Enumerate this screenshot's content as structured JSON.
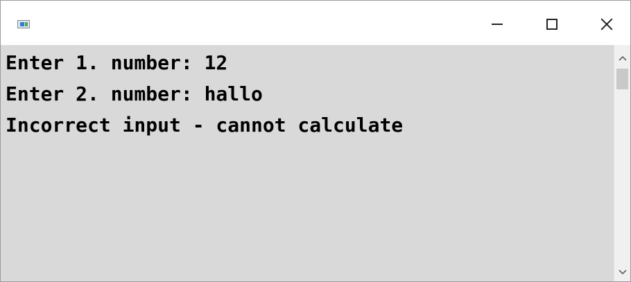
{
  "window": {
    "icon": "console-app-icon",
    "controls": {
      "minimize": "minimize-icon",
      "maximize": "maximize-icon",
      "close": "close-icon"
    }
  },
  "console": {
    "lines": [
      "Enter 1. number: 12",
      "Enter 2. number: hallo",
      "Incorrect input - cannot calculate"
    ],
    "background": "#d9d9d9",
    "text_color": "#000000"
  },
  "scrollbar": {
    "up": "chevron-up-icon",
    "down": "chevron-down-icon"
  }
}
